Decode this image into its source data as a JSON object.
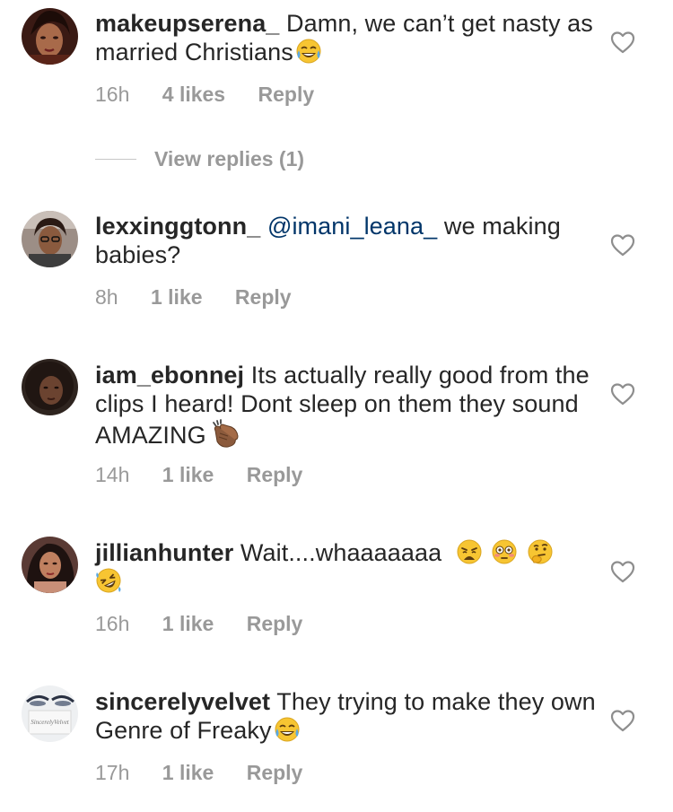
{
  "comments": [
    {
      "username": "makeupserena_",
      "text": "Damn, we can’t get nasty as married Christians",
      "emojis": [
        "face-with-tears-of-joy"
      ],
      "time": "16h",
      "likes": "4 likes",
      "reply": "Reply"
    },
    {
      "username": "lexxinggtonn_",
      "mention": "@imani_leana_",
      "text": "we making babies?",
      "time": "8h",
      "likes": "1 like",
      "reply": "Reply"
    },
    {
      "username": "iam_ebonnej",
      "text": "Its actually really good from the clips I heard! Dont sleep on them they sound AMAZING",
      "emojis": [
        "clapping-hands"
      ],
      "time": "14h",
      "likes": "1 like",
      "reply": "Reply"
    },
    {
      "username": "jillianhunter",
      "text": "Wait....whaaaaaaa",
      "emojis": [
        "weary-face",
        "flushed-face",
        "thinking-face",
        "rolling-on-floor-laughing"
      ],
      "time": "16h",
      "likes": "1 like",
      "reply": "Reply"
    },
    {
      "username": "sincerelyvelvet",
      "text": "They trying to make they own Genre of Freaky",
      "emojis": [
        "face-with-tears-of-joy"
      ],
      "time": "17h",
      "likes": "1 like",
      "reply": "Reply",
      "avatar_text": "SincerelyVelvet"
    }
  ],
  "view_replies": "View replies (1)",
  "icons": {
    "like": "heart-outline-icon"
  },
  "colors": {
    "text": "#262626",
    "meta": "#999999",
    "mention": "#003569"
  }
}
